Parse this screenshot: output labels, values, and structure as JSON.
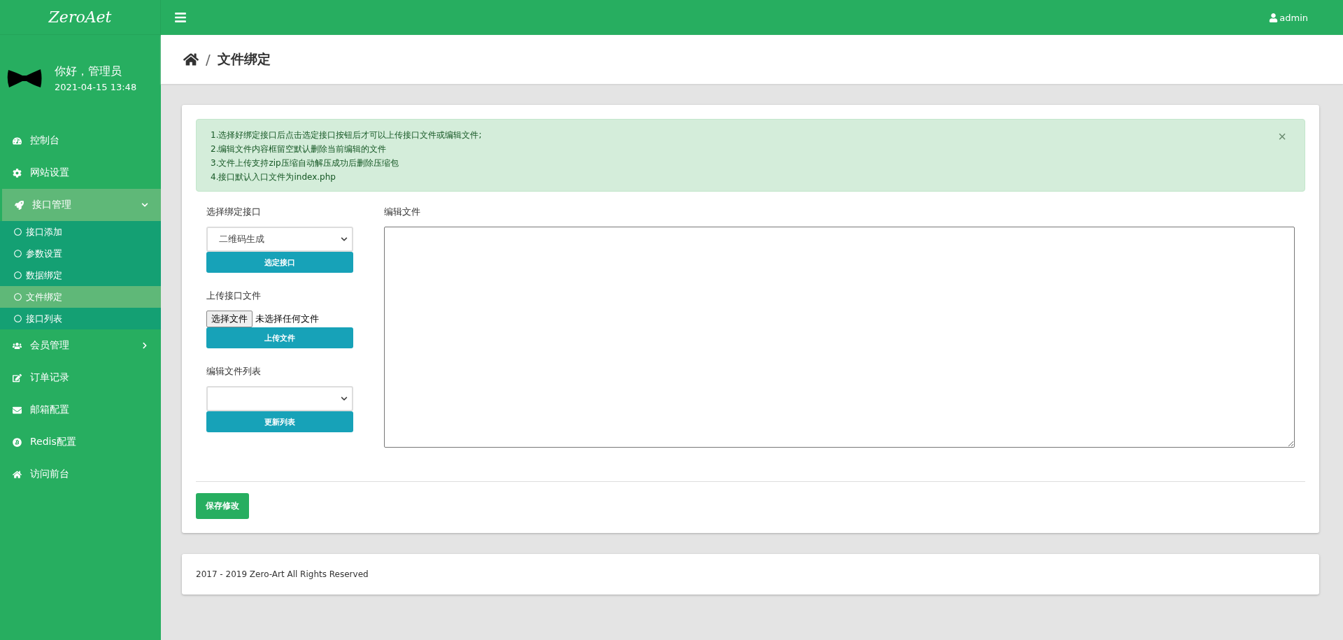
{
  "brand": {
    "logo": "ZeroAet"
  },
  "topbar": {
    "user": "admin"
  },
  "profile": {
    "greeting": "你好，管理员",
    "datetime": "2021-04-15 13:48"
  },
  "sidebar": {
    "items": [
      {
        "label": "控制台",
        "selected": false
      },
      {
        "label": "网站设置",
        "selected": false
      },
      {
        "label": "接口管理",
        "selected": true,
        "expanded": true,
        "children": [
          {
            "label": "接口添加",
            "selected": false
          },
          {
            "label": "参数设置",
            "selected": false
          },
          {
            "label": "数据绑定",
            "selected": false
          },
          {
            "label": "文件绑定",
            "selected": true
          },
          {
            "label": "接口列表",
            "selected": false
          }
        ]
      },
      {
        "label": "会员管理",
        "selected": false,
        "expanded": false
      },
      {
        "label": "订单记录",
        "selected": false
      },
      {
        "label": "邮箱配置",
        "selected": false
      },
      {
        "label": "Redis配置",
        "selected": false
      },
      {
        "label": "访问前台",
        "selected": false
      }
    ]
  },
  "breadcrumb": {
    "separator": "/",
    "title": "文件绑定"
  },
  "alert": {
    "close": "×",
    "lines": [
      "1.选择好绑定接口后点击选定接口按钮后才可以上传接口文件或编辑文件;",
      "2.编辑文件内容框留空默认删除当前编辑的文件",
      "3.文件上传支持zip压缩自动解压成功后删除压缩包",
      "4.接口默认入口文件为index.php"
    ]
  },
  "form": {
    "bind_label": "选择绑定接口",
    "bind_value": "二维码生成",
    "bind_button": "选定接口",
    "upload_label": "上传接口文件",
    "file_button": "选择文件",
    "file_status": "未选择任何文件",
    "upload_button": "上传文件",
    "list_label": "编辑文件列表",
    "list_button": "更新列表",
    "editor_label": "编辑文件"
  },
  "save_button": "保存修改",
  "footer": "2017 - 2019 Zero-Art All Rights Reserved"
}
